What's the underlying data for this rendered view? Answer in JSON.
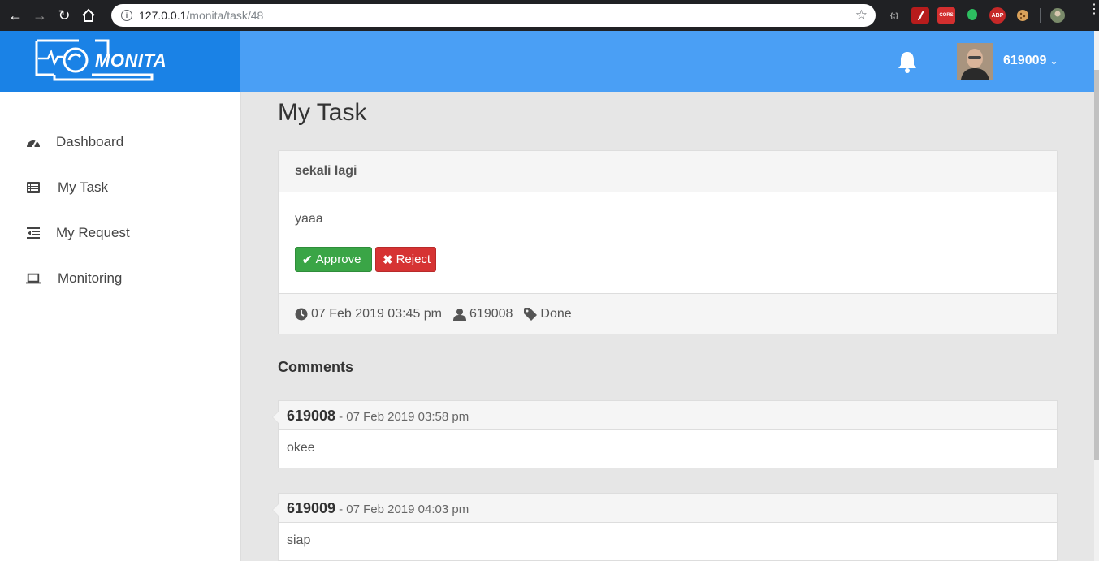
{
  "browser": {
    "url_host": "127.0.0.1",
    "url_path": "/monita/task/48",
    "extensions": [
      {
        "name": "json-viewer-icon",
        "label": "{;}",
        "color": "#202124"
      },
      {
        "name": "flash-icon",
        "label": "",
        "color": "#b71c1c"
      },
      {
        "name": "cors-icon",
        "label": "CORS",
        "color": "#d32f2f"
      },
      {
        "name": "evernote-icon",
        "label": "",
        "color": "#202124"
      },
      {
        "name": "adblock-icon",
        "label": "ABP",
        "color": "#c62828"
      },
      {
        "name": "cookie-icon",
        "label": "",
        "color": "#202124"
      }
    ]
  },
  "header": {
    "logo_text": "MONITA",
    "user_name": "619009",
    "colors": {
      "header_bg": "#4a9ff5",
      "logo_bg": "#1a82e6"
    }
  },
  "sidebar": {
    "items": [
      {
        "label": "Dashboard",
        "icon": "dashboard-icon"
      },
      {
        "label": "My Task",
        "icon": "list-icon"
      },
      {
        "label": "My Request",
        "icon": "outdent-icon"
      },
      {
        "label": "Monitoring",
        "icon": "laptop-icon"
      }
    ]
  },
  "main": {
    "page_title": "My Task",
    "task": {
      "title": "sekali lagi",
      "description": "yaaa",
      "approve_label": "Approve",
      "reject_label": "Reject",
      "date": "07 Feb 2019 03:45 pm",
      "user": "619008",
      "status": "Done"
    },
    "comments_title": "Comments",
    "comments": [
      {
        "author": "619008",
        "date": "- 07 Feb 2019 03:58 pm",
        "text": "okee"
      },
      {
        "author": "619009",
        "date": "- 07 Feb 2019 04:03 pm",
        "text": "siap"
      }
    ]
  }
}
